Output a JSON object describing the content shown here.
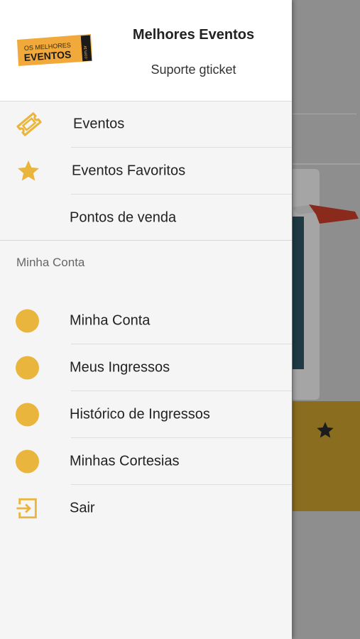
{
  "colors": {
    "accent": "#eab53c",
    "scrim": "#8e8e8e",
    "drawer_bg": "#f5f5f5"
  },
  "header": {
    "logo_text_top": "OS MELHORES",
    "logo_text_main": "EVENTOS",
    "logo_text_side": ".com.br",
    "title": "Melhores Eventos",
    "subtitle": "Suporte gticket"
  },
  "menu": [
    {
      "label": "Eventos",
      "icon": "ticket-icon"
    },
    {
      "label": "Eventos Favoritos",
      "icon": "star-icon"
    },
    {
      "label": "Pontos de venda",
      "icon": ""
    }
  ],
  "account_section": {
    "title": "Minha Conta",
    "items": [
      {
        "label": "Minha Conta",
        "icon": "circle-icon"
      },
      {
        "label": "Meus Ingressos",
        "icon": "circle-icon"
      },
      {
        "label": "Histórico de Ingressos",
        "icon": "circle-icon"
      },
      {
        "label": "Minhas Cortesias",
        "icon": "circle-icon"
      },
      {
        "label": "Sair",
        "icon": "logout-icon"
      }
    ]
  }
}
